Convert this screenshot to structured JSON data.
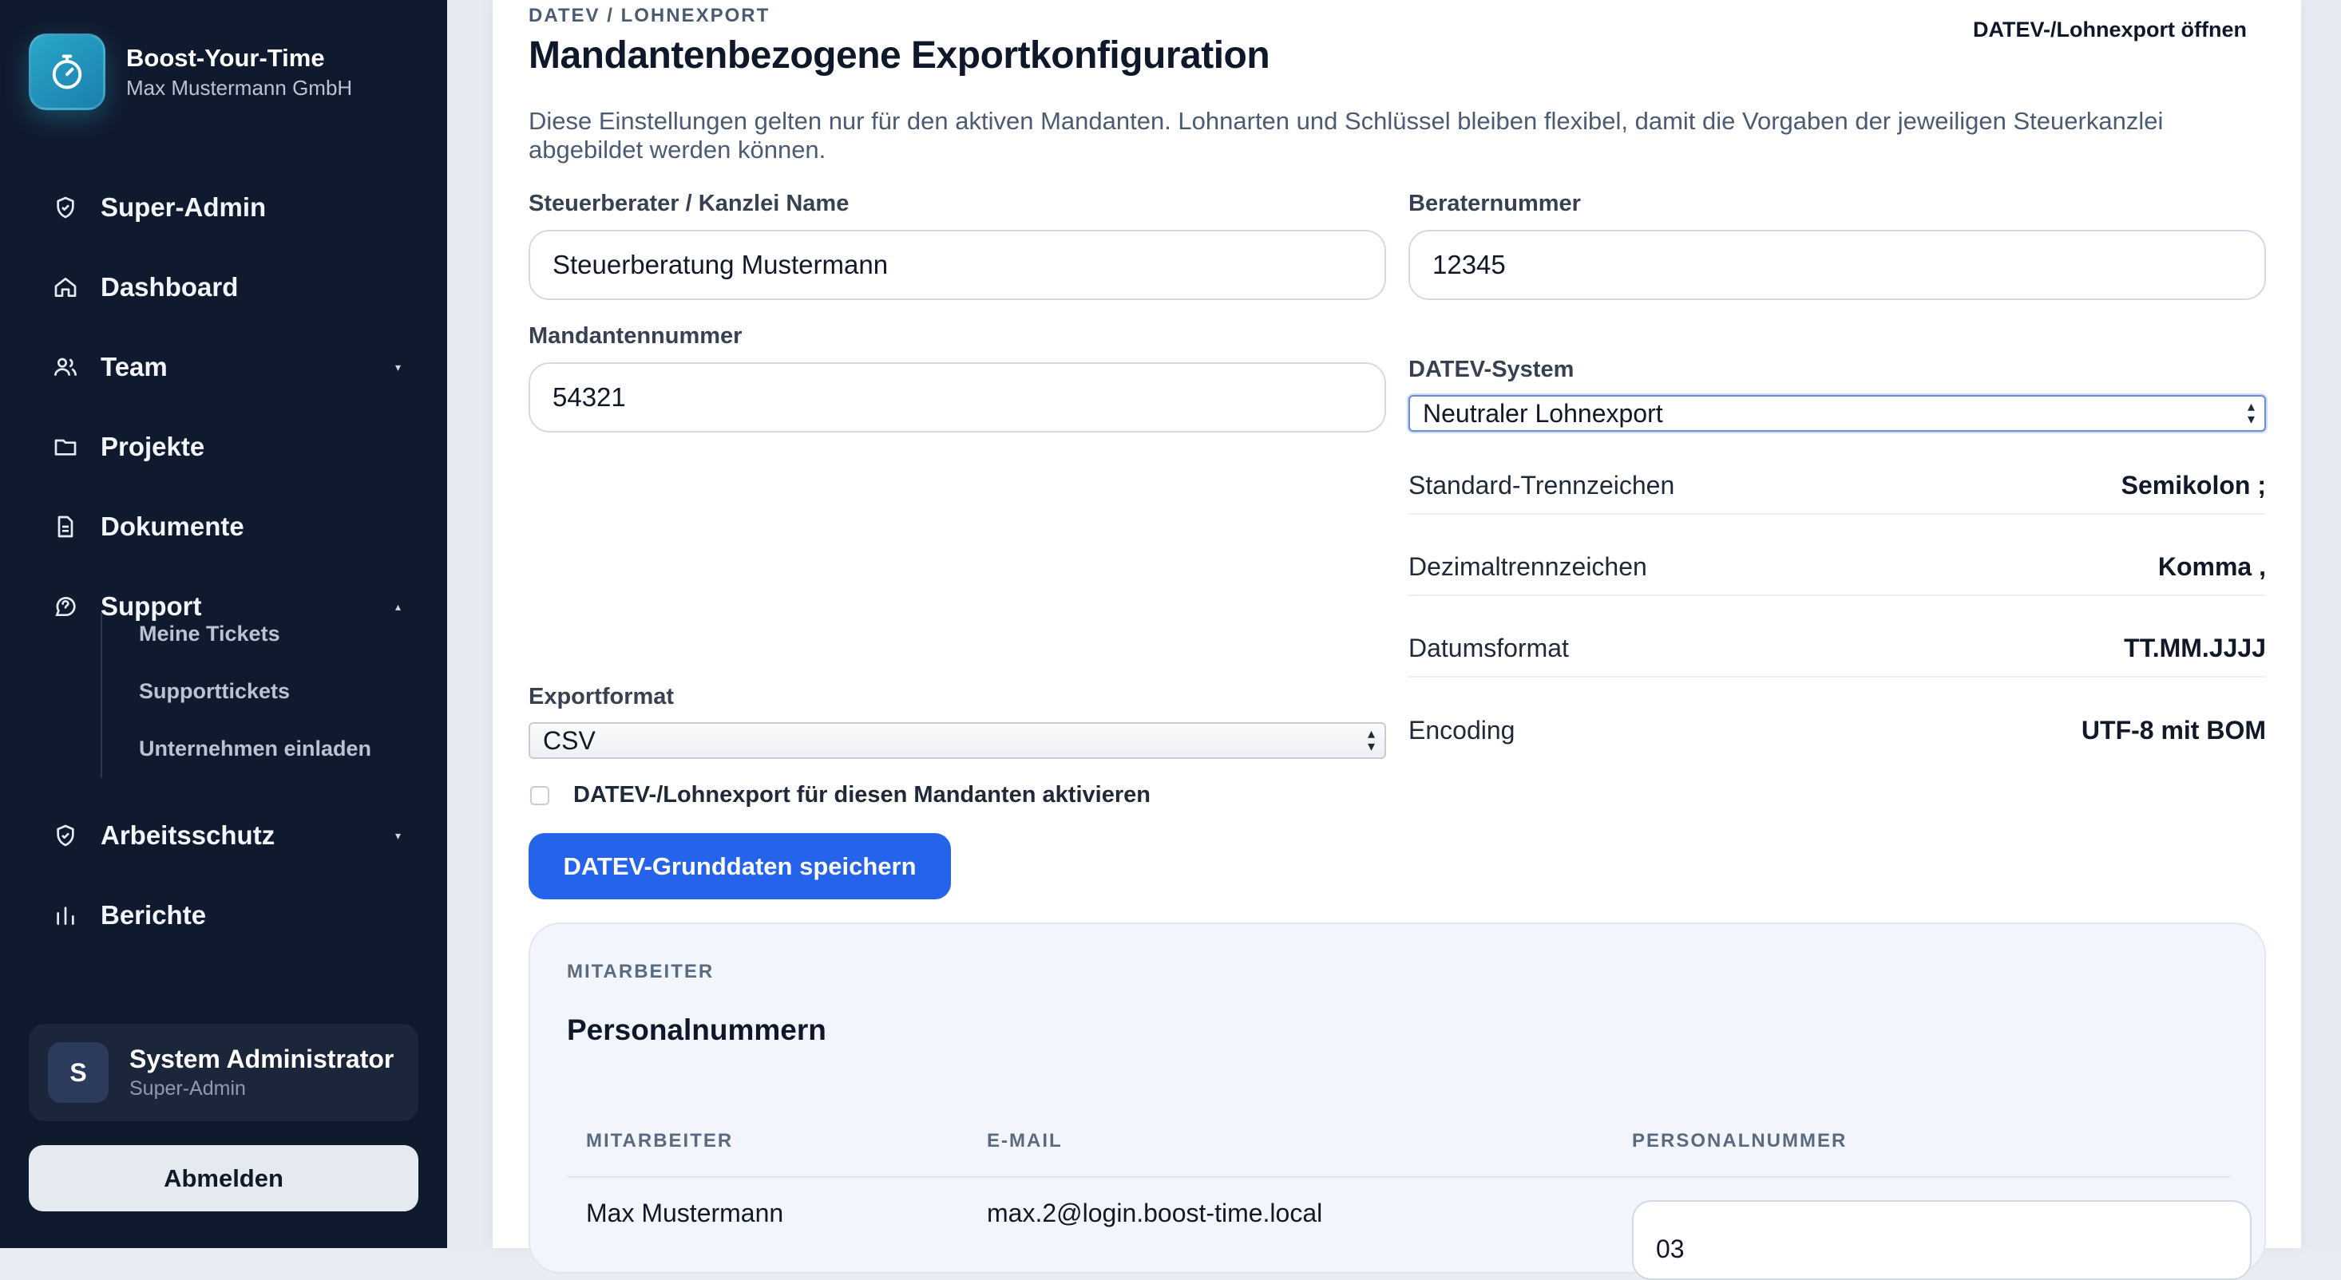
{
  "brand": {
    "title": "Boost-Your-Time",
    "subtitle": "Max Mustermann GmbH"
  },
  "nav": {
    "items": [
      {
        "label": "Super-Admin",
        "icon": "shield-check-icon"
      },
      {
        "label": "Dashboard",
        "icon": "home-icon"
      },
      {
        "label": "Team",
        "icon": "users-icon",
        "caret": "▾"
      },
      {
        "label": "Projekte",
        "icon": "folder-icon"
      },
      {
        "label": "Dokumente",
        "icon": "document-icon"
      },
      {
        "label": "Support",
        "icon": "help-circle-icon",
        "caret": "▴"
      },
      {
        "label": "Arbeitsschutz",
        "icon": "shield-check-icon",
        "caret": "▾"
      },
      {
        "label": "Berichte",
        "icon": "bar-chart-icon"
      }
    ],
    "support_sub": [
      "Meine Tickets",
      "Supporttickets",
      "Unternehmen einladen"
    ]
  },
  "user": {
    "initial": "S",
    "name": "System Administrator",
    "role": "Super-Admin"
  },
  "logout_label": "Abmelden",
  "header": {
    "eyebrow": "DATEV / LOHNEXPORT",
    "title": "Mandantenbezogene Exportkonfiguration",
    "open_link": "DATEV-/Lohnexport öffnen",
    "description": "Diese Einstellungen gelten nur für den aktiven Mandanten. Lohnarten und Schlüssel bleiben flexibel, damit die Vorgaben der jeweiligen Steuerkanzlei abgebildet werden können."
  },
  "form": {
    "kanzlei_label": "Steuerberater / Kanzlei Name",
    "kanzlei_value": "Steuerberatung Mustermann",
    "berater_label": "Beraternummer",
    "berater_value": "12345",
    "mandant_label": "Mandantennummer",
    "mandant_value": "54321",
    "system_label": "DATEV-System",
    "system_value": "Neutraler Lohnexport",
    "format_label": "Exportformat",
    "format_value": "CSV",
    "activate_label": "DATEV-/Lohnexport für diesen Mandanten aktivieren",
    "activate_checked": false,
    "save_label": "DATEV-Grunddaten speichern"
  },
  "settings": [
    {
      "key": "Standard-Trennzeichen",
      "value": "Semikolon ;"
    },
    {
      "key": "Dezimaltrennzeichen",
      "value": "Komma ,"
    },
    {
      "key": "Datumsformat",
      "value": "TT.MM.JJJJ"
    },
    {
      "key": "Encoding",
      "value": "UTF-8 mit BOM"
    }
  ],
  "employees": {
    "eyebrow": "MITARBEITER",
    "title": "Personalnummern",
    "columns": [
      "MITARBEITER",
      "E-MAIL",
      "PERSONALNUMMER"
    ],
    "rows": [
      {
        "name": "Max Mustermann",
        "email": "max.2@login.boost-time.local",
        "personalnummer": "03"
      }
    ]
  },
  "colors": {
    "accent": "#2563eb",
    "sidebar": "#101a2e",
    "brand_logo": "#1f93bd"
  }
}
